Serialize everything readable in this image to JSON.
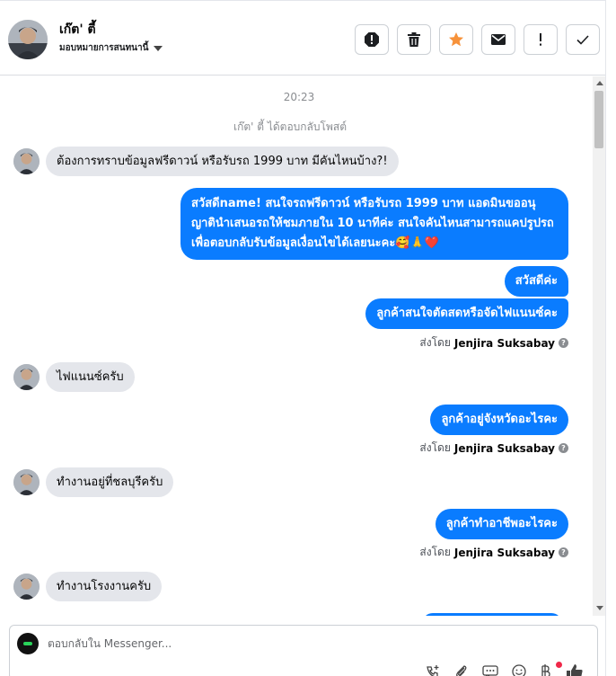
{
  "contact": {
    "name": "เก๊ต' ตี้",
    "assign_label": "มอบหมายการสนทนานี้"
  },
  "header_actions": [
    {
      "name": "spam-icon"
    },
    {
      "name": "trash-icon"
    },
    {
      "name": "star-icon",
      "color": "#f7923a"
    },
    {
      "name": "mail-icon"
    },
    {
      "name": "exclamation-icon"
    },
    {
      "name": "check-icon"
    }
  ],
  "chat": {
    "timestamp": "20:23",
    "system_note": "เก๊ต' ตี้ ได้ตอบกลับโพสต์",
    "messages": [
      {
        "text": "ต้องการทราบข้อมูลฟรีดาวน์ หรือรับรถ 1999 บาท มีคันไหนบ้าง?!"
      },
      {
        "text": "สวัสดีname! สนใจรถฟรีดาวน์ หรือรับรถ 1999 บาท แอดมินขออนุญาตินำเสนอรถให้ชมภายใน 10 นาทีค่ะ สนใจคันไหนสามารถแคปรูปรถเพื่อตอบกลับรับข้อมูลเงื่อนไขได้เลยนะคะ🥰🙏❤️"
      },
      {
        "text": "สวัสดีค่ะ"
      },
      {
        "text": "ลูกค้าสนใจตัดสดหรือจัดไฟแนนซ์คะ"
      },
      {
        "text": "ไฟแนนซ์ครับ"
      },
      {
        "text": "ลูกค้าอยู่จังหวัดอะไรคะ"
      },
      {
        "text": "ทำงานอยู่ที่ชลบุรีครับ"
      },
      {
        "text": "ลูกค้าทำอาชีพอะไรคะ"
      },
      {
        "text": "ทำงานโรงงานครับ"
      }
    ],
    "sent_by_prefix": "ส่งโดย",
    "sent_by_name": "Jenjira Suksabay"
  },
  "composer": {
    "placeholder": "ตอบกลับใน Messenger..."
  },
  "colors": {
    "outgoing": "#0a7cff",
    "incoming": "#e4e6eb",
    "accent_star": "#f7923a"
  }
}
